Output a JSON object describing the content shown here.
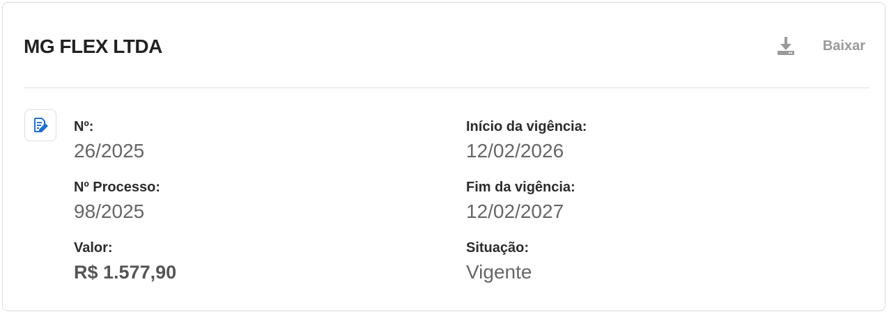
{
  "card": {
    "title": "MG FLEX LTDA",
    "download_label": "Baixar",
    "download_icon": "download-icon",
    "doc_icon": "document-edit-icon",
    "accent_color": "#1f6fd1"
  },
  "fields": {
    "numero": {
      "label": "Nº:",
      "value": "26/2025"
    },
    "processo": {
      "label": "Nº Processo:",
      "value": "98/2025"
    },
    "valor": {
      "label": "Valor:",
      "value": "R$ 1.577,90"
    },
    "inicio": {
      "label": "Início da vigência:",
      "value": "12/02/2026"
    },
    "fim": {
      "label": "Fim da vigência:",
      "value": "12/02/2027"
    },
    "situacao": {
      "label": "Situação:",
      "value": "Vigente"
    }
  }
}
